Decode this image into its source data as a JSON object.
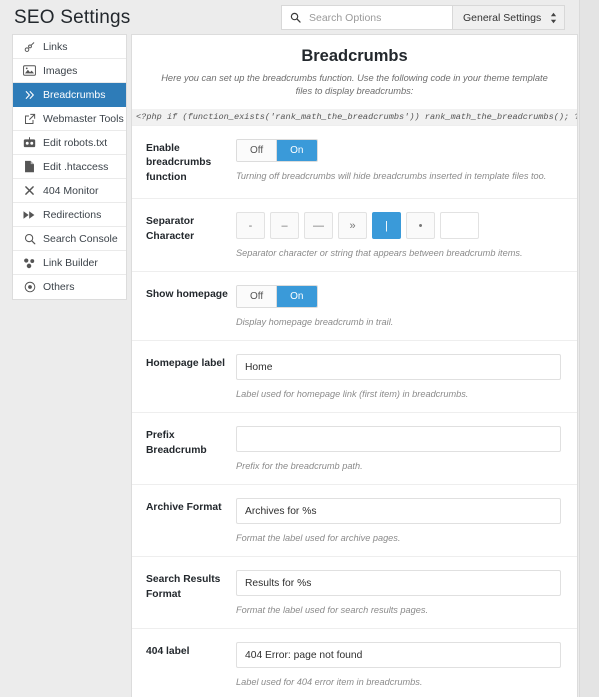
{
  "header": {
    "title": "SEO Settings",
    "search": {
      "placeholder": "Search Options",
      "value": "",
      "icon": "search-icon"
    },
    "settings_select": {
      "value": "General Settings",
      "icon": "chevron-updown-icon"
    }
  },
  "sidebar": {
    "items": [
      {
        "label": "Links",
        "icon": "link-icon",
        "active": false
      },
      {
        "label": "Images",
        "icon": "image-icon",
        "active": false
      },
      {
        "label": "Breadcrumbs",
        "icon": "chevron-double-right-icon",
        "active": true
      },
      {
        "label": "Webmaster Tools",
        "icon": "external-link-icon",
        "active": false
      },
      {
        "label": "Edit robots.txt",
        "icon": "robot-icon",
        "active": false
      },
      {
        "label": "Edit .htaccess",
        "icon": "file-icon",
        "active": false
      },
      {
        "label": "404 Monitor",
        "icon": "close-x-icon",
        "active": false
      },
      {
        "label": "Redirections",
        "icon": "fast-forward-icon",
        "active": false
      },
      {
        "label": "Search Console",
        "icon": "magnifier-icon",
        "active": false
      },
      {
        "label": "Link Builder",
        "icon": "chain-links-icon",
        "active": false
      },
      {
        "label": "Others",
        "icon": "circle-dot-icon",
        "active": false
      }
    ]
  },
  "main": {
    "title": "Breadcrumbs",
    "description": "Here you can set up the breadcrumbs function. Use the following code in your theme template files to display breadcrumbs:",
    "code_snippet": "<?php if (function_exists('rank_math_the_breadcrumbs')) rank_math_the_breadcrumbs(); ?>",
    "rows": {
      "enable": {
        "label": "Enable breadcrumbs function",
        "off_label": "Off",
        "on_label": "On",
        "state": "On",
        "help": "Turning off breadcrumbs will hide breadcrumbs inserted in template files too."
      },
      "separator": {
        "label": "Separator Character",
        "options": [
          "-",
          "–",
          "—",
          "»",
          "|",
          "•"
        ],
        "selected": "|",
        "custom_value": "",
        "help": "Separator character or string that appears between breadcrumb items."
      },
      "show_homepage": {
        "label": "Show homepage",
        "off_label": "Off",
        "on_label": "On",
        "state": "On",
        "help": "Display homepage breadcrumb in trail."
      },
      "homepage_label": {
        "label": "Homepage label",
        "value": "Home",
        "help": "Label used for homepage link (first item) in breadcrumbs."
      },
      "prefix": {
        "label": "Prefix Breadcrumb",
        "value": "",
        "help": "Prefix for the breadcrumb path."
      },
      "archive_format": {
        "label": "Archive Format",
        "value": "Archives for %s",
        "help": "Format the label used for archive pages."
      },
      "search_format": {
        "label": "Search Results Format",
        "value": "Results for %s",
        "help": "Format the label used for search results pages."
      },
      "notfound_label": {
        "label": "404 label",
        "value": "404 Error: page not found",
        "help": "Label used for 404 error item in breadcrumbs."
      }
    }
  },
  "colors": {
    "accent_blue": "#3a9ad9",
    "sidebar_active": "#2e7cb8",
    "page_bg": "#ececec"
  }
}
